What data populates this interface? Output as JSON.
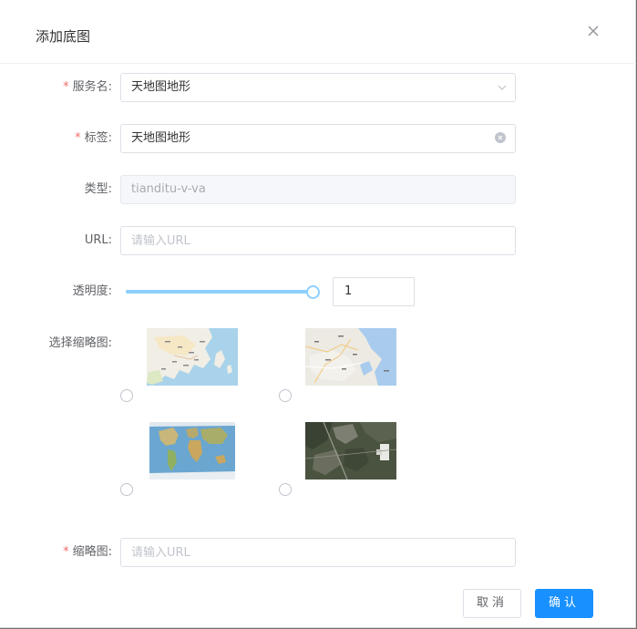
{
  "dialog": {
    "title": "添加底图",
    "close_icon": "close-icon"
  },
  "form": {
    "service_name": {
      "label": "服务名:",
      "required": true,
      "value": "天地图地形",
      "icon": "chevron-down-icon"
    },
    "tag": {
      "label": "标签:",
      "required": true,
      "value": "天地图地形",
      "icon": "clear-icon"
    },
    "type": {
      "label": "类型:",
      "value": "tianditu-v-va",
      "disabled": true
    },
    "url": {
      "label": "URL:",
      "placeholder": "请输入URL"
    },
    "opacity": {
      "label": "透明度:",
      "value": "1",
      "slider_fraction": 1.0
    },
    "thumbnail_select": {
      "label": "选择缩略图:",
      "options": [
        {
          "name": "vector-map-thumbnail",
          "selected": false
        },
        {
          "name": "street-map-thumbnail",
          "selected": false
        },
        {
          "name": "terrain-world-map-thumbnail",
          "selected": false
        },
        {
          "name": "satellite-image-thumbnail",
          "selected": false
        }
      ]
    },
    "thumbnail_url": {
      "label": "缩略图:",
      "required": true,
      "placeholder": "请输入URL"
    }
  },
  "footer": {
    "cancel_label": "取消",
    "confirm_label": "确认"
  },
  "colors": {
    "primary": "#1890ff",
    "required": "#f56c6c",
    "slider": "#8dd0ff"
  }
}
